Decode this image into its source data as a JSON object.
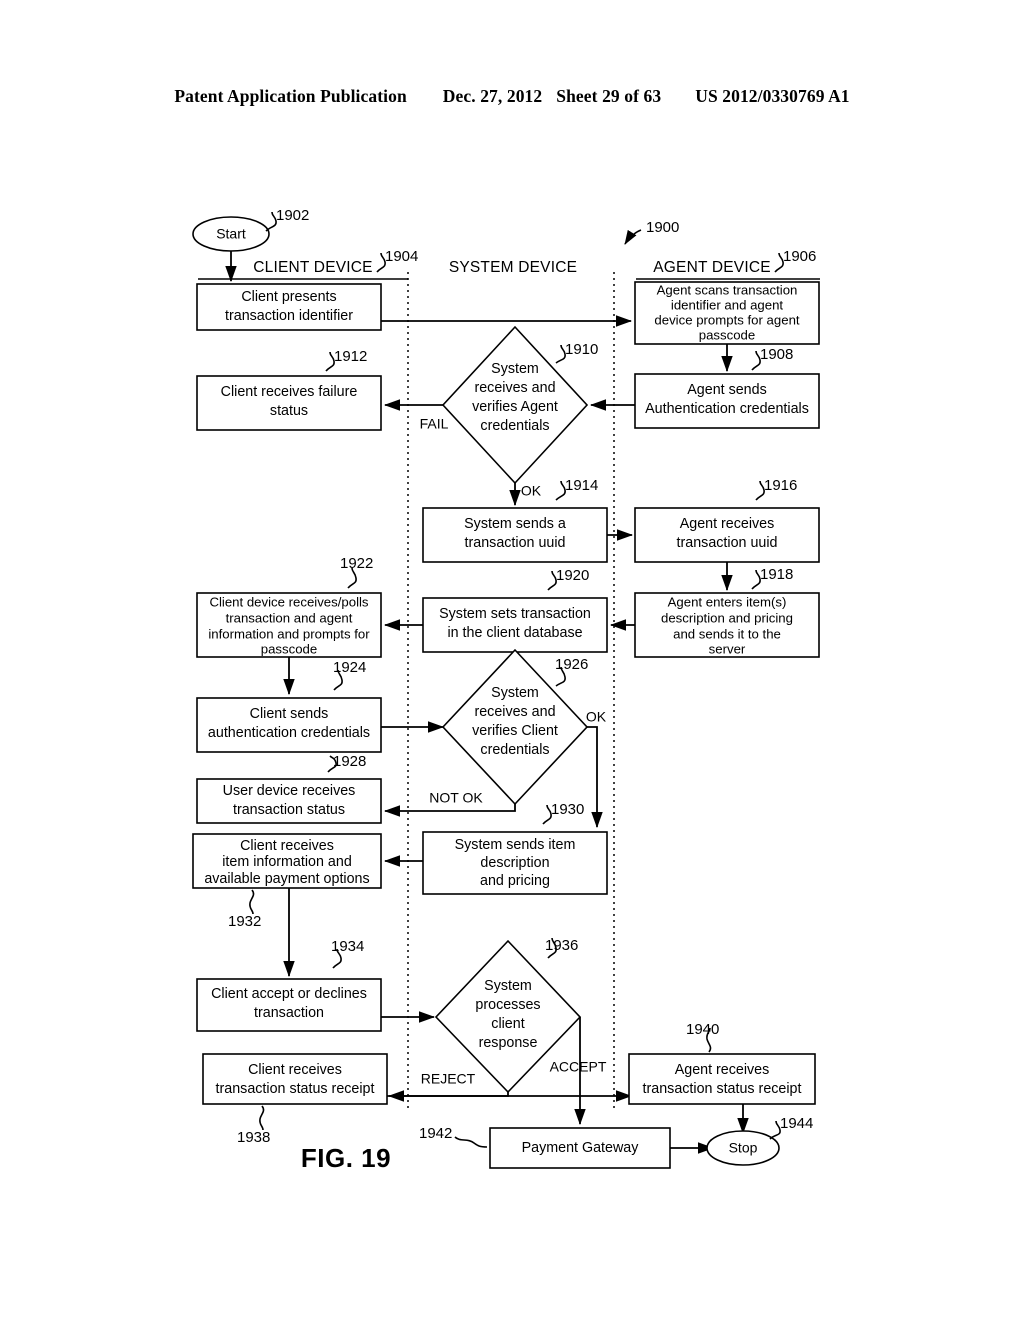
{
  "header": {
    "publication": "Patent Application Publication",
    "date": "Dec. 27, 2012",
    "sheet": "Sheet 29 of 63",
    "patent_number": "US 2012/0330769 A1"
  },
  "figure": {
    "caption": "FIG. 19",
    "diagram_ref": "1900",
    "lanes": [
      {
        "id": "client",
        "label": "CLIENT DEVICE",
        "ref": "1904"
      },
      {
        "id": "system",
        "label": "SYSTEM DEVICE",
        "ref": ""
      },
      {
        "id": "agent",
        "label": "AGENT DEVICE",
        "ref": "1906"
      }
    ],
    "nodes": [
      {
        "id": "n1902",
        "ref": "1902",
        "shape": "terminator",
        "lane": "client",
        "text": "Start"
      },
      {
        "id": "n1904",
        "ref": "1904",
        "shape": "process",
        "lane": "client",
        "lines": [
          "Client presents",
          "transaction identifier"
        ]
      },
      {
        "id": "n1906",
        "ref": "1906",
        "shape": "process",
        "lane": "agent",
        "lines": [
          "Agent scans transaction",
          "identifier and agent",
          "device prompts for agent",
          "passcode"
        ]
      },
      {
        "id": "n1908",
        "ref": "1908",
        "shape": "process",
        "lane": "agent",
        "lines": [
          "Agent sends",
          "Authentication credentials"
        ]
      },
      {
        "id": "n1910",
        "ref": "1910",
        "shape": "decision",
        "lane": "system",
        "lines": [
          "System",
          "receives and",
          "verifies Agent",
          "credentials"
        ]
      },
      {
        "id": "n1912",
        "ref": "1912",
        "shape": "process",
        "lane": "client",
        "lines": [
          "Client receives failure",
          "status"
        ]
      },
      {
        "id": "n1914",
        "ref": "1914",
        "shape": "process",
        "lane": "system",
        "lines": [
          "System sends a",
          "transaction uuid"
        ]
      },
      {
        "id": "n1916",
        "ref": "1916",
        "shape": "process",
        "lane": "agent",
        "lines": [
          "Agent receives",
          "transaction uuid"
        ]
      },
      {
        "id": "n1918",
        "ref": "1918",
        "shape": "process",
        "lane": "agent",
        "lines": [
          "Agent enters item(s)",
          "description and pricing",
          "and sends it to the",
          "server"
        ]
      },
      {
        "id": "n1920",
        "ref": "1920",
        "shape": "process",
        "lane": "system",
        "lines": [
          "System sets transaction",
          "in the client database"
        ]
      },
      {
        "id": "n1922",
        "ref": "1922",
        "shape": "process",
        "lane": "client",
        "lines": [
          "Client device receives/polls",
          "transaction and agent",
          "information and prompts for",
          "passcode"
        ]
      },
      {
        "id": "n1924",
        "ref": "1924",
        "shape": "process",
        "lane": "client",
        "lines": [
          "Client sends",
          "authentication credentials"
        ]
      },
      {
        "id": "n1926",
        "ref": "1926",
        "shape": "decision",
        "lane": "system",
        "lines": [
          "System",
          "receives and",
          "verifies Client",
          "credentials"
        ]
      },
      {
        "id": "n1928",
        "ref": "1928",
        "shape": "process",
        "lane": "client",
        "lines": [
          "User device receives",
          "transaction status"
        ]
      },
      {
        "id": "n1930",
        "ref": "1930",
        "shape": "process",
        "lane": "system",
        "lines": [
          "System sends item",
          "description",
          "and pricing"
        ]
      },
      {
        "id": "n1932",
        "ref": "1932",
        "shape": "process",
        "lane": "client",
        "lines": [
          "Client receives",
          "item information and",
          "available payment options"
        ]
      },
      {
        "id": "n1934",
        "ref": "1934",
        "shape": "process",
        "lane": "client",
        "lines": [
          "Client accept or declines",
          "transaction"
        ]
      },
      {
        "id": "n1936",
        "ref": "1936",
        "shape": "decision",
        "lane": "system",
        "lines": [
          "System",
          "processes",
          "client",
          "response"
        ]
      },
      {
        "id": "n1938",
        "ref": "1938",
        "shape": "process",
        "lane": "client",
        "lines": [
          "Client receives",
          "transaction status receipt"
        ]
      },
      {
        "id": "n1940",
        "ref": "1940",
        "shape": "process",
        "lane": "agent",
        "lines": [
          "Agent receives",
          "transaction status receipt"
        ]
      },
      {
        "id": "n1942",
        "ref": "1942",
        "shape": "process",
        "lane": "system",
        "lines": [
          "Payment Gateway"
        ]
      },
      {
        "id": "n1944",
        "ref": "1944",
        "shape": "terminator",
        "lane": "agent",
        "text": "Stop"
      }
    ],
    "edge_labels": {
      "fail": "FAIL",
      "ok_agent": "OK",
      "ok_client": "OK",
      "not_ok": "NOT OK",
      "reject": "REJECT",
      "accept": "ACCEPT"
    }
  }
}
